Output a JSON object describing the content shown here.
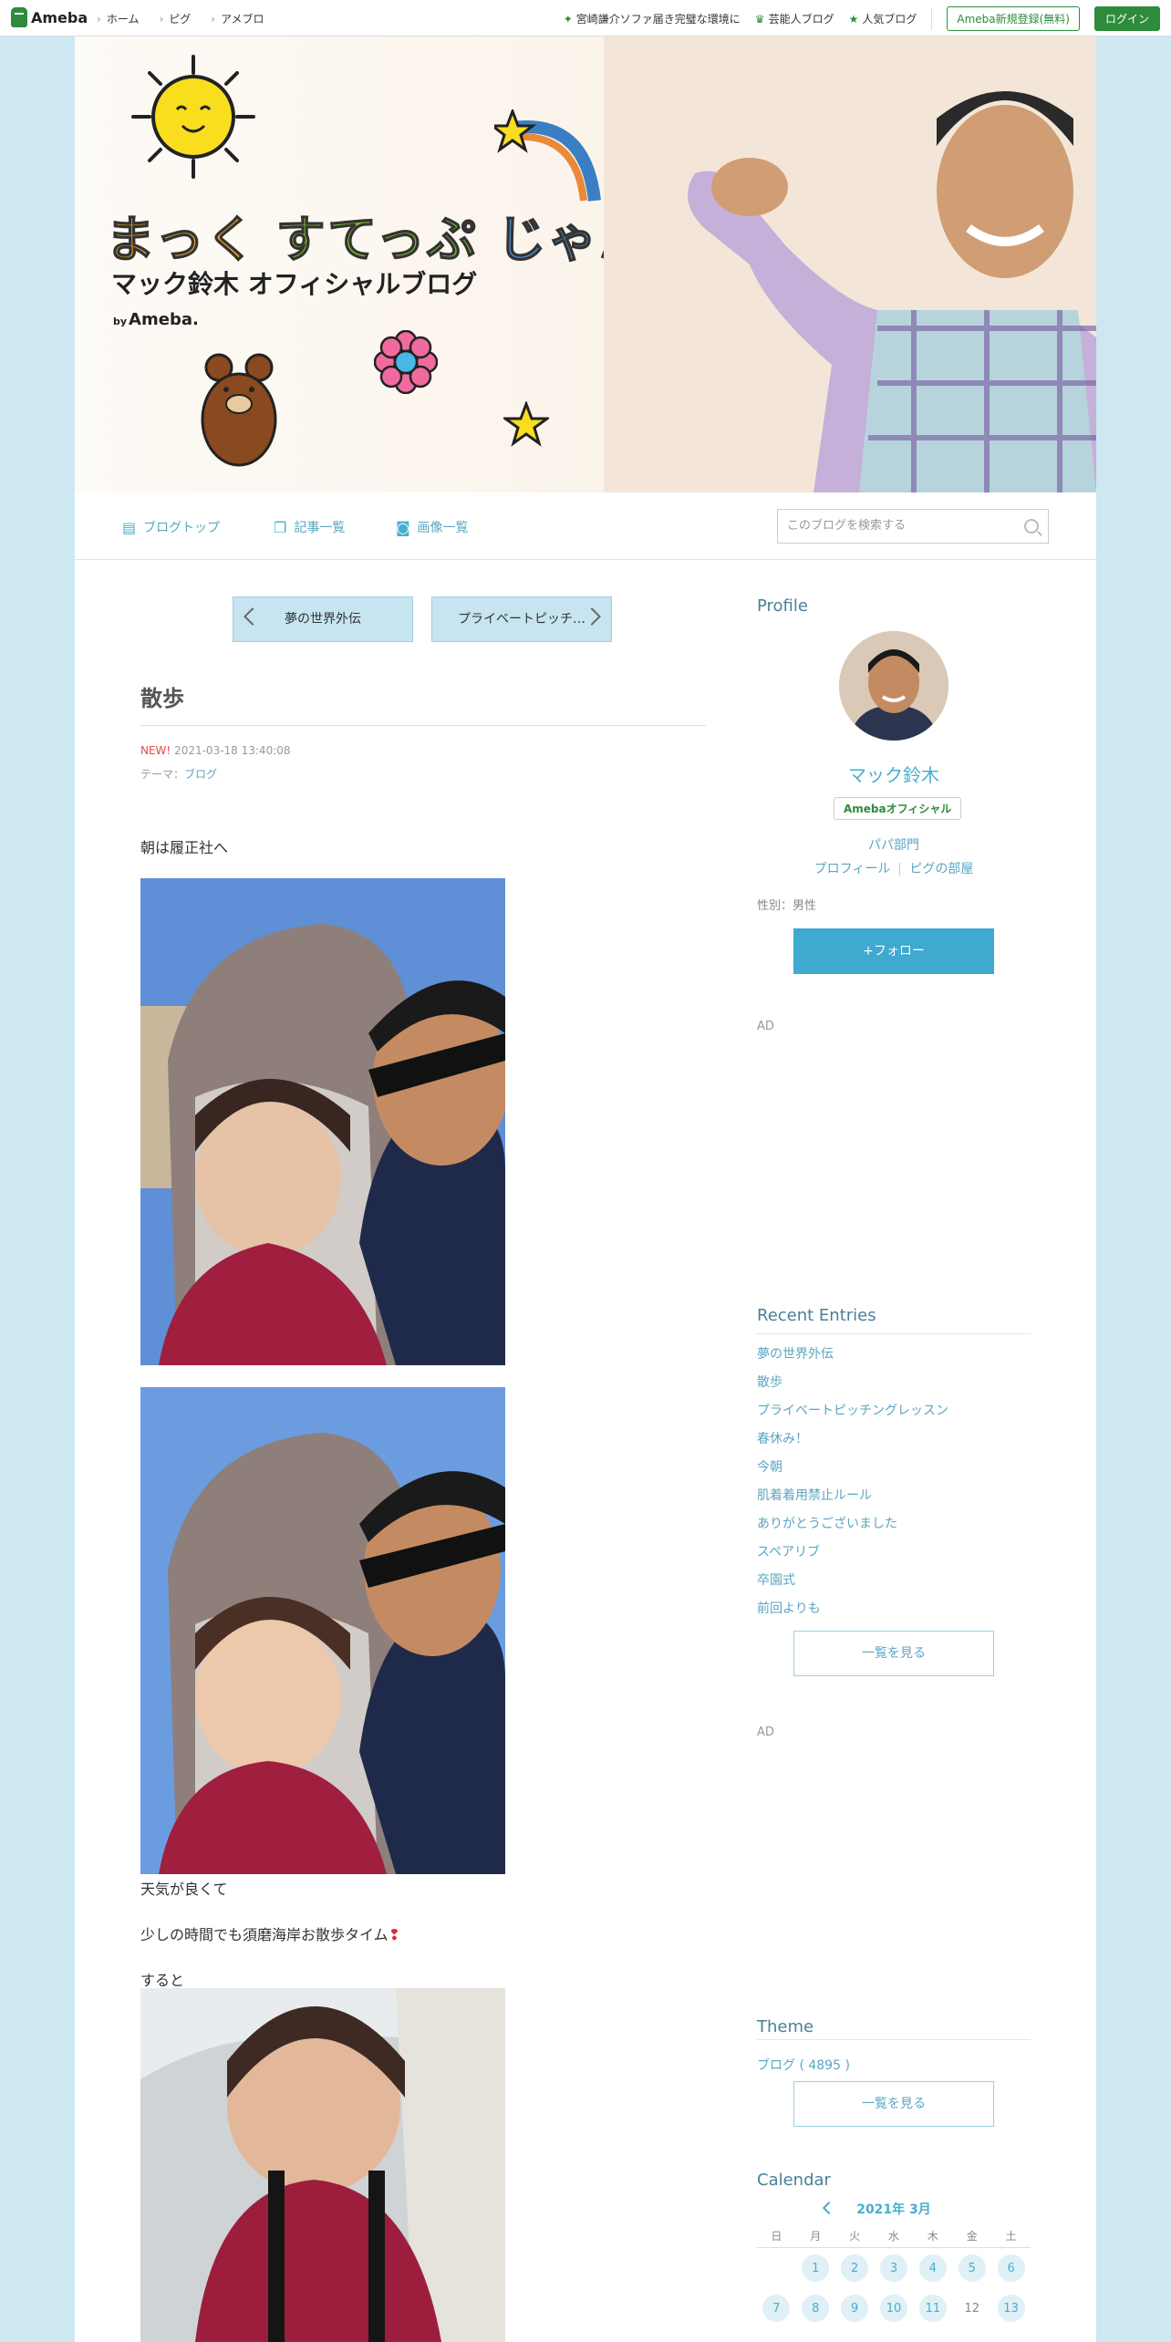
{
  "topbar": {
    "logo": "Ameba",
    "nav": [
      "ホーム",
      "ピグ",
      "アメブロ"
    ],
    "links": [
      "宮崎謙介ソファ届き完璧な環境に",
      "芸能人ブログ",
      "人気ブログ"
    ],
    "register": "Ameba新規登録(無料)",
    "login": "ログイン"
  },
  "header": {
    "title_part1": "まっく",
    "title_part2": "すてっぷ",
    "title_part3": "じゃんぷ",
    "subtitle": "マック鈴木 オフィシャルブログ",
    "by": "by",
    "brand": "Ameba."
  },
  "subnav": {
    "items": [
      "ブログトップ",
      "記事一覧",
      "画像一覧"
    ],
    "search_placeholder": "このブログを検索する"
  },
  "entry": {
    "prev": "夢の世界外伝",
    "next": "プライベートピッチ…",
    "title": "散歩",
    "new_label": "NEW!",
    "date": "2021-03-18 13:40:08",
    "theme_label": "テーマ：",
    "theme": "ブログ",
    "p1": "朝は履正社へ",
    "p2": "天気が良くて",
    "p3": "少しの時間でも須磨海岸お散歩タイム",
    "p4": "すると"
  },
  "sidebar": {
    "profile_heading": "Profile",
    "name": "マック鈴木",
    "badge": "Amebaオフィシャル",
    "link1": "パパ部門",
    "link2": "プロフィール",
    "link3": "ピグの部屋",
    "gender": "性別：男性",
    "follow": "+フォロー",
    "ad": "AD",
    "recent_heading": "Recent Entries",
    "recent": [
      "夢の世界外伝",
      "散歩",
      "プライベートピッチングレッスン",
      "春休み！",
      "今朝",
      "肌着着用禁止ルール",
      "ありがとうございました",
      "スペアリブ",
      "卒園式",
      "前回よりも"
    ],
    "see_all": "一覧を見る",
    "theme_heading": "Theme",
    "theme_item": "ブログ ( 4895 )",
    "calendar_heading": "Calendar",
    "calendar_month": "2021年 3月",
    "weekdays": [
      "日",
      "月",
      "火",
      "水",
      "木",
      "金",
      "土"
    ],
    "week1": [
      "",
      "1",
      "2",
      "3",
      "4",
      "5",
      "6"
    ],
    "week2": [
      "7",
      "8",
      "9",
      "10",
      "11",
      "12",
      "13"
    ]
  },
  "colors": {
    "accent": "#48aed0",
    "ameba_green": "#2d8c3c",
    "page_bg": "#cde8f0"
  }
}
